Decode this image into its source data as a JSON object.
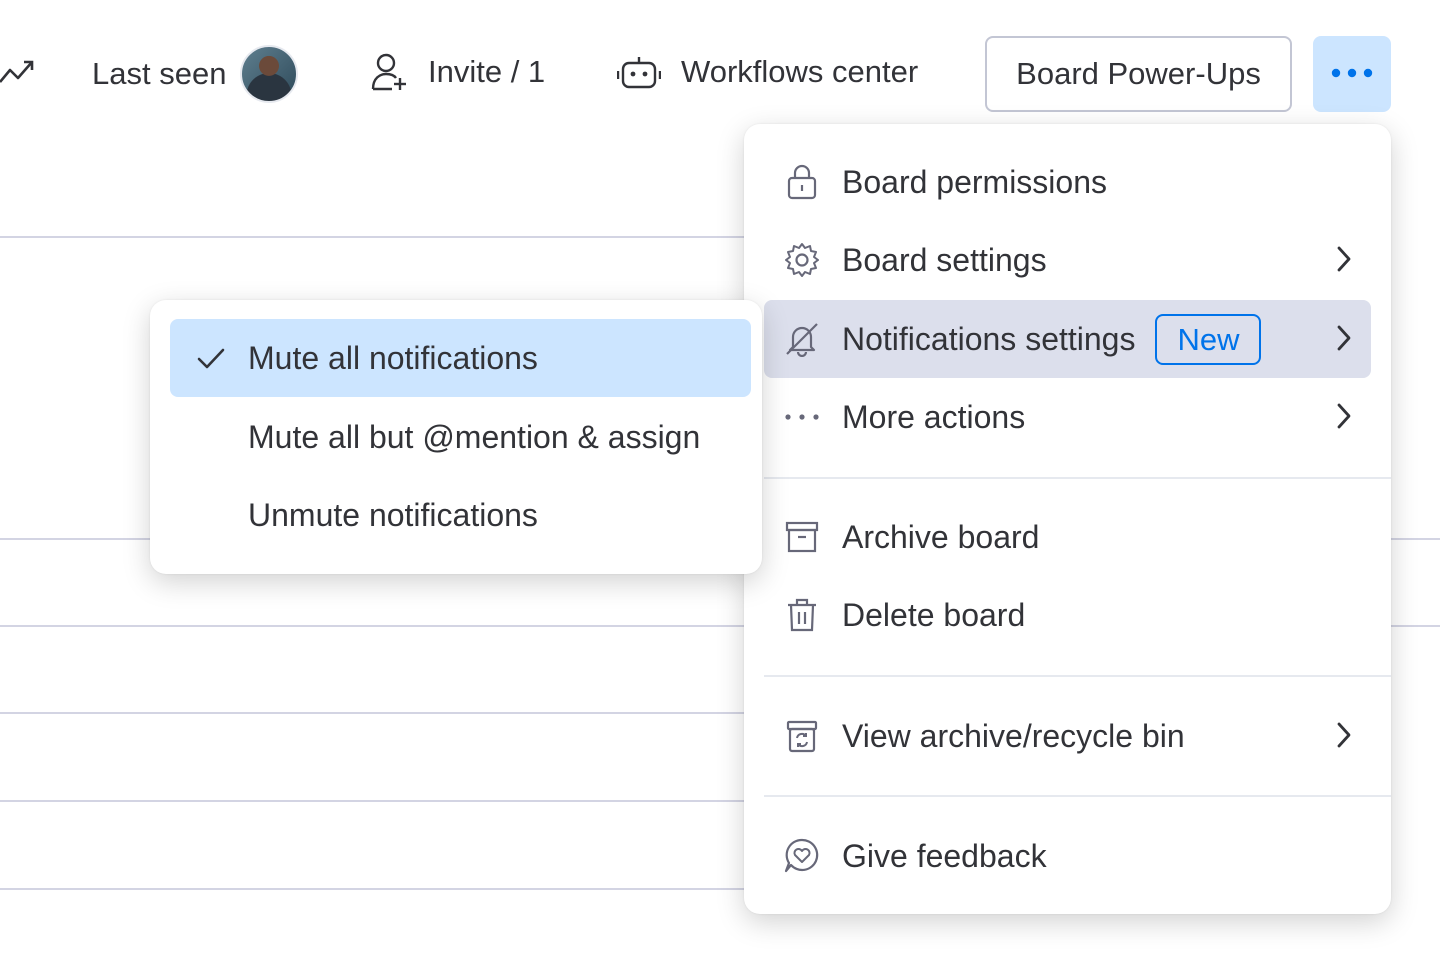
{
  "topbar": {
    "last_seen_label": "Last seen",
    "invite_label": "Invite / 1",
    "workflows_label": "Workflows center",
    "powerups_label": "Board Power-Ups",
    "more_icon": "ellipsis-icon"
  },
  "menu": {
    "items": [
      {
        "label": "Board permissions",
        "icon": "lock-icon"
      },
      {
        "label": "Board settings",
        "icon": "gear-icon"
      },
      {
        "label": "Notifications settings",
        "icon": "bell-off-icon",
        "badge": "New"
      },
      {
        "label": "More actions",
        "icon": "ellipsis-icon"
      },
      {
        "label": "Archive board",
        "icon": "archive-icon"
      },
      {
        "label": "Delete board",
        "icon": "trash-icon"
      },
      {
        "label": "View archive/recycle bin",
        "icon": "recycle-bin-icon"
      },
      {
        "label": "Give feedback",
        "icon": "feedback-icon"
      }
    ]
  },
  "submenu": {
    "items": [
      {
        "label": "Mute all notifications",
        "selected": true
      },
      {
        "label": "Mute all but @mention & assign"
      },
      {
        "label": "Unmute notifications"
      }
    ]
  },
  "colors": {
    "accent": "#0073ea",
    "selected_bg": "#cce5ff",
    "hover_bg": "#dcdfec",
    "text": "#323338"
  }
}
